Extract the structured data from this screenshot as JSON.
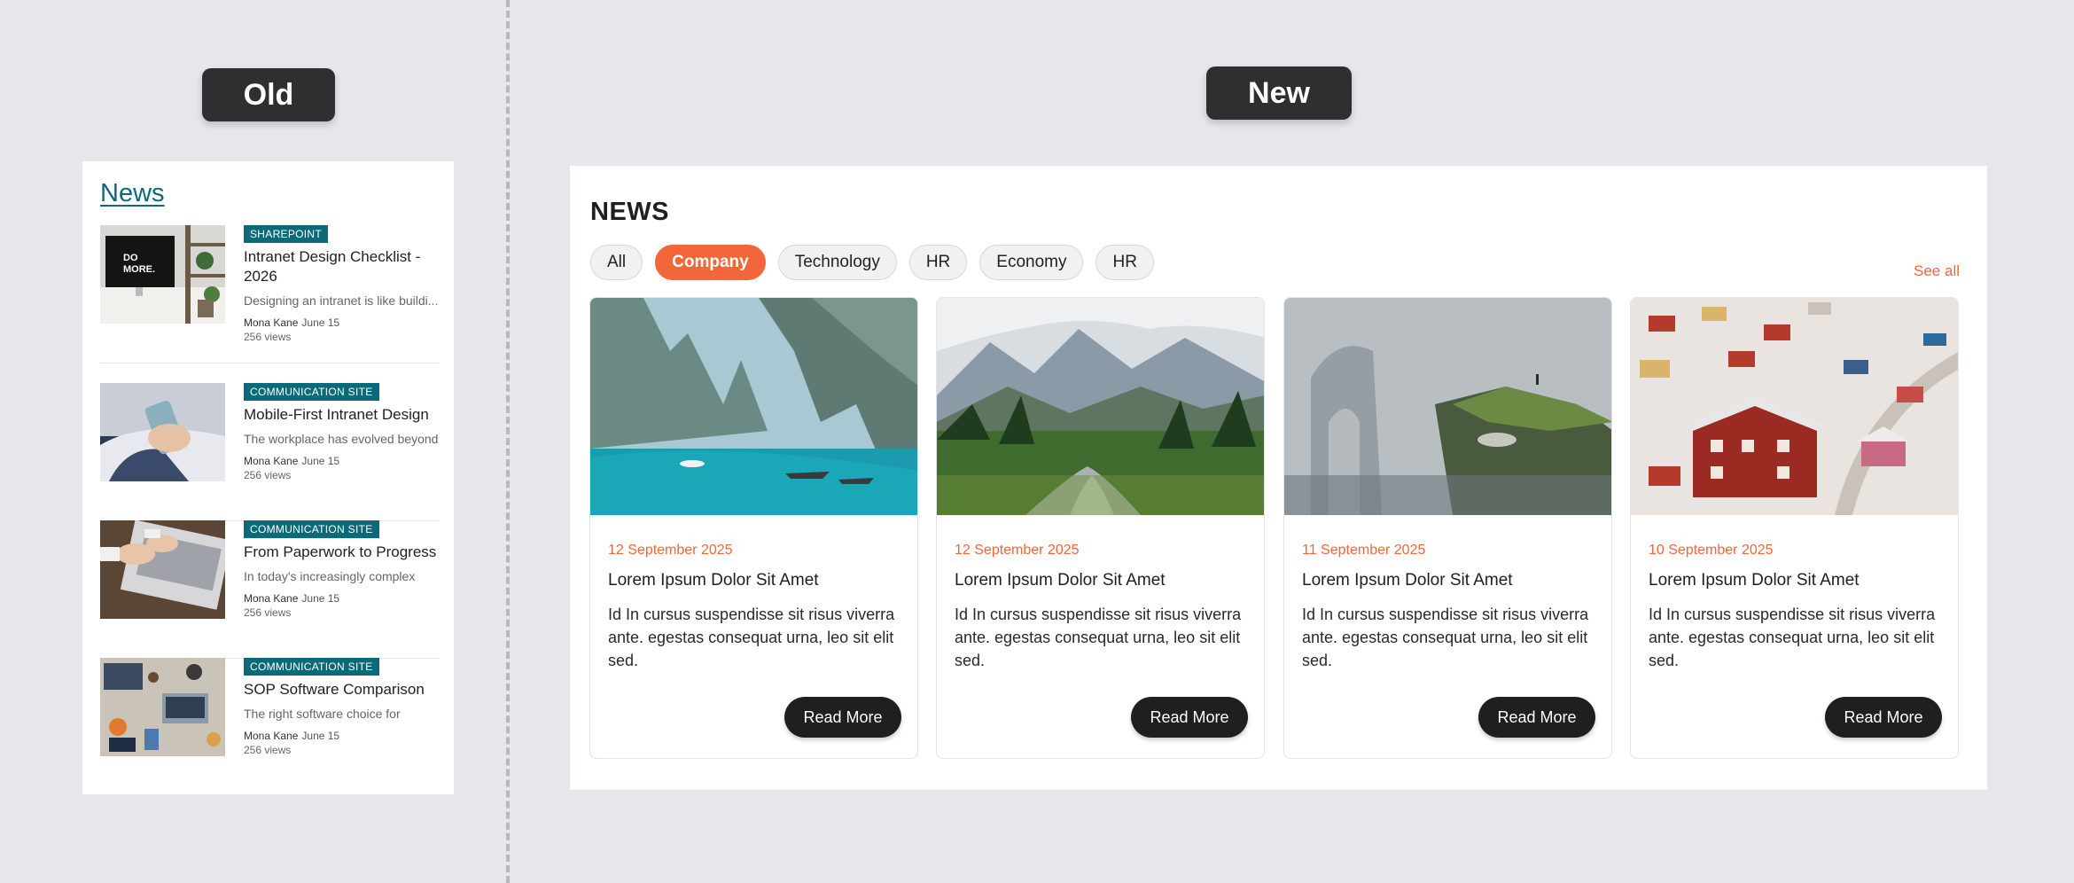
{
  "labels": {
    "old": "Old",
    "new": "New"
  },
  "old": {
    "title": "News",
    "items": [
      {
        "badge": "SHAREPOINT",
        "headline": "Intranet Design Checklist - 2026",
        "excerpt": "Designing an intranet is like buildi...",
        "author": "Mona Kane",
        "date": "June 15",
        "views": "256 views",
        "image": "desk-computer"
      },
      {
        "badge": "COMMUNICATION SITE",
        "headline": "Mobile-First Intranet Design",
        "excerpt": "The workplace has evolved beyond",
        "author": "Mona Kane",
        "date": "June 15",
        "views": "256 views",
        "image": "hand-phone"
      },
      {
        "badge": "COMMUNICATION SITE",
        "headline": "From Paperwork to Progress",
        "excerpt": "In today's increasingly complex",
        "author": "Mona Kane",
        "date": "June 15",
        "views": "256 views",
        "image": "hands-laptop"
      },
      {
        "badge": "COMMUNICATION SITE",
        "headline": "SOP Software Comparison",
        "excerpt": "The right software choice for",
        "author": "Mona Kane",
        "date": "June 15",
        "views": "256 views",
        "image": "desk-overhead"
      }
    ]
  },
  "new": {
    "title": "NEWS",
    "filters": [
      "All",
      "Company",
      "Technology",
      "HR",
      "Economy",
      "HR"
    ],
    "active_filter": "Company",
    "see_all": "See all",
    "cards": [
      {
        "date": "12 September 2025",
        "title": "Lorem Ipsum Dolor Sit Amet",
        "text": "Id In cursus suspendisse sit risus viverra ante. egestas consequat urna, leo sit elit sed.",
        "button": "Read More",
        "image": "tropical-lagoon"
      },
      {
        "date": "12 September 2025",
        "title": "Lorem Ipsum Dolor Sit Amet",
        "text": "Id In cursus suspendisse sit risus viverra ante. egestas consequat urna, leo sit elit sed.",
        "button": "Read More",
        "image": "mountain-valley"
      },
      {
        "date": "11 September 2025",
        "title": "Lorem Ipsum Dolor Sit Amet",
        "text": "Id In cursus suspendisse sit risus viverra ante. egestas consequat urna, leo sit elit sed.",
        "button": "Read More",
        "image": "foggy-cliff"
      },
      {
        "date": "10 September 2025",
        "title": "Lorem Ipsum Dolor Sit Amet",
        "text": "Id In cursus suspendisse sit risus viverra ante. egestas consequat urna, leo sit elit sed.",
        "button": "Read More",
        "image": "snowy-village"
      }
    ]
  },
  "colors": {
    "accent": "#f26639",
    "teal": "#0b6a7a",
    "dark": "#1f1f21",
    "background": "#e8e6ea"
  }
}
